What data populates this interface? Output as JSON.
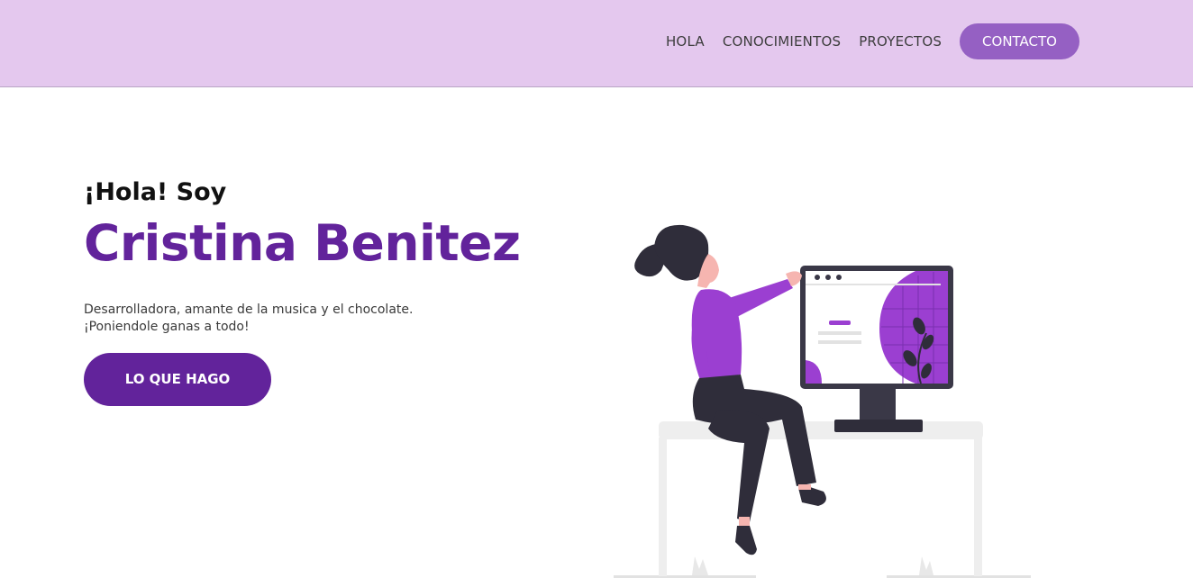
{
  "nav": {
    "items": [
      {
        "label": "HOLA"
      },
      {
        "label": "CONOCIMIENTOS"
      },
      {
        "label": "PROYECTOS"
      }
    ],
    "cta_label": "CONTACTO"
  },
  "hero": {
    "greeting": "¡Hola! Soy",
    "name": "Cristina Benitez",
    "description_line1": "Desarrolladora, amante de la musica y el chocolate.",
    "description_line2": "¡Poniendole ganas a todo!",
    "button_label": "LO QUE HAGO"
  },
  "illustration": {
    "icon": "woman-at-computer-illustration"
  },
  "colors": {
    "header_bg": "#e4c8ee",
    "accent": "#9560c3",
    "primary": "#62239b",
    "figure_purple": "#9b3fd1",
    "dark": "#2f2d3a"
  }
}
